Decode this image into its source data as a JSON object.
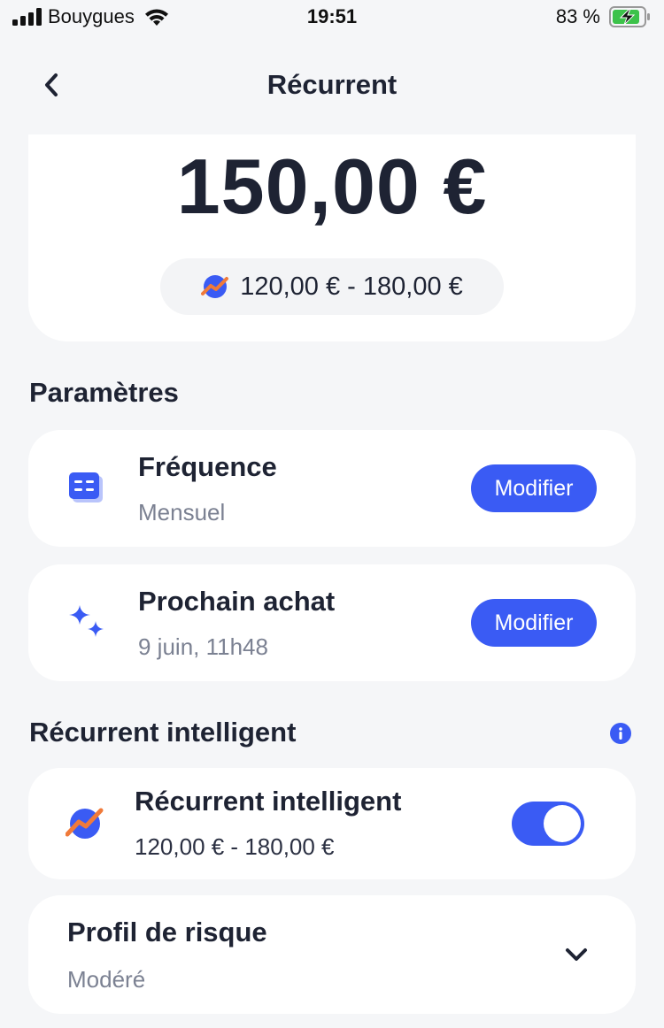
{
  "status_bar": {
    "carrier": "Bouygues",
    "time": "19:51",
    "battery": "83 %"
  },
  "nav": {
    "title": "Récurrent",
    "back_icon": "chevron-left-icon"
  },
  "amount": {
    "value": "150,00 €",
    "range": "120,00 € - 180,00 €"
  },
  "parametres": {
    "section_title": "Paramètres",
    "frequence": {
      "title": "Fréquence",
      "value": "Mensuel",
      "button": "Modifier",
      "icon": "calendar-icon"
    },
    "prochain_achat": {
      "title": "Prochain achat",
      "value": "9 juin, 11h48",
      "button": "Modifier",
      "icon": "sparkle-icon"
    }
  },
  "recurrent_intelligent": {
    "section_title": "Récurrent intelligent",
    "card_title": "Récurrent intelligent",
    "range": "120,00 € - 180,00 €",
    "enabled": true
  },
  "profil": {
    "title": "Profil de risque",
    "value": "Modéré"
  },
  "colors": {
    "accent": "#3a5bf4",
    "background": "#f5f6f8",
    "trend_orange": "#f07a3a"
  }
}
